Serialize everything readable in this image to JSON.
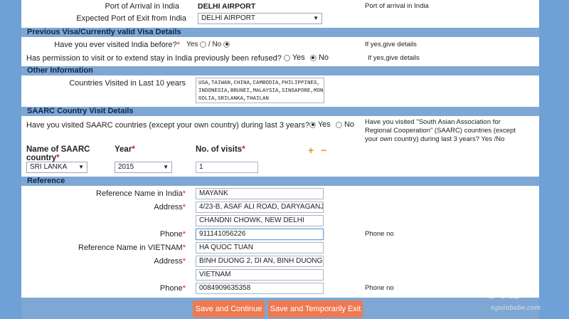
{
  "top": {
    "port_arrival_label": "Port of Arrival in India",
    "port_arrival_value": "DELHI AIRPORT",
    "port_arrival_hint": "Port of arrival in India",
    "port_exit_label": "Expected Port of Exit from India",
    "port_exit_value": "DELHI AIRPORT"
  },
  "prev_visa": {
    "header": "Previous Visa/Currently valid Visa Details",
    "q1_label": "Have you ever visited India before?",
    "q1_yes": "Yes",
    "q1_no": "/ No",
    "q1_selected": "No",
    "q1_hint": "If yes,give details",
    "q2_label": "Has permission to visit or to extend stay in India previously been refused?",
    "q2_yes": "Yes",
    "q2_no": "No",
    "q2_selected": "No",
    "q2_hint": "If yes,give details"
  },
  "other": {
    "header": "Other Information",
    "countries_label": "Countries Visited in Last 10 years",
    "countries_value": "USA,TAIWAN,CHINA,CAMBODIA,PHILIPPINES,\nINDONESIA,BRUNEI,MALAYSIA,SINGAPORE,MON\nGOLIA,SRILANKA,THAILAN"
  },
  "saarc": {
    "header": "SAARC Country Visit Details",
    "question": "Have you visited SAARC countries (except your own country) during last 3 years?",
    "yes": "Yes",
    "no": "No",
    "selected": "Yes",
    "hint": "Have you visited \"South Asian Association for\nRegional Cooperation\" (SAARC) countries (except\nyour own country) during last 3 years? Yes /No",
    "col_name": "Name of SAARC country",
    "col_year": "Year",
    "col_visits": "No. of visits",
    "row_country": "SRI LANKA",
    "row_year": "2015",
    "row_visits": "1",
    "plus": "+",
    "minus": "−"
  },
  "reference": {
    "header": "Reference",
    "ref_india_label": "Reference Name in India",
    "ref_india_value": "MAYANK",
    "address_label": "Address",
    "india_addr1": "4/23-B, ASAF ALI ROAD, DARYAGANJ",
    "india_addr2": "CHANDNI CHOWK, NEW DELHI",
    "phone_label": "Phone",
    "india_phone": "911141056226",
    "phone_hint": "Phone no",
    "ref_vn_label": "Reference Name in VIETNAM",
    "ref_vn_value": "HA QUOC TUAN",
    "vn_addr1": "BINH DUONG 2, DI AN, BINH DUONG",
    "vn_addr2": "VIETNAM",
    "vn_phone": "0084909635358"
  },
  "buttons": {
    "save_continue": "Save and Continue",
    "save_exit": "Save and Temporarily Exit"
  },
  "watermark": "nguinbabe.com",
  "colors": {
    "section_bar": "#7ea8d3",
    "background": "#6fa0d6",
    "button": "#ee7a51",
    "required": "#d21f1f",
    "plus_minus": "#f08a1c"
  }
}
